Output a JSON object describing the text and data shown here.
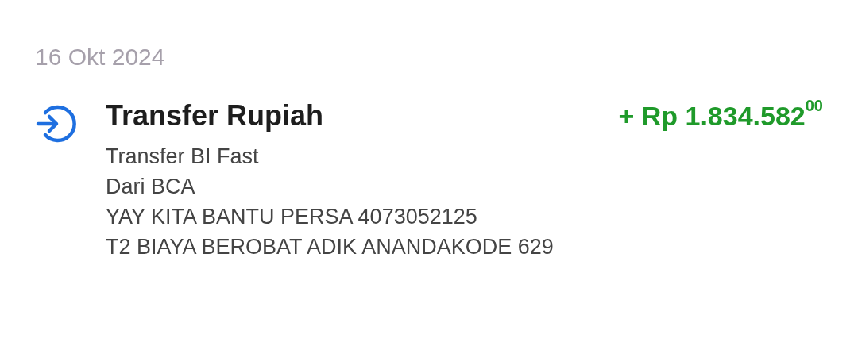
{
  "date": "16 Okt 2024",
  "transaction": {
    "title": "Transfer Rupiah",
    "amount": "+ Rp 1.834.582$^{00}$",
    "incoming": true,
    "details": [
      "Transfer BI Fast",
      "Dari BCA",
      "YAY KITA BANTU PERSA 4073052125",
      "T2 BIAYA BEROBAT ADIK ANANDAKODE 629"
    ]
  }
}
